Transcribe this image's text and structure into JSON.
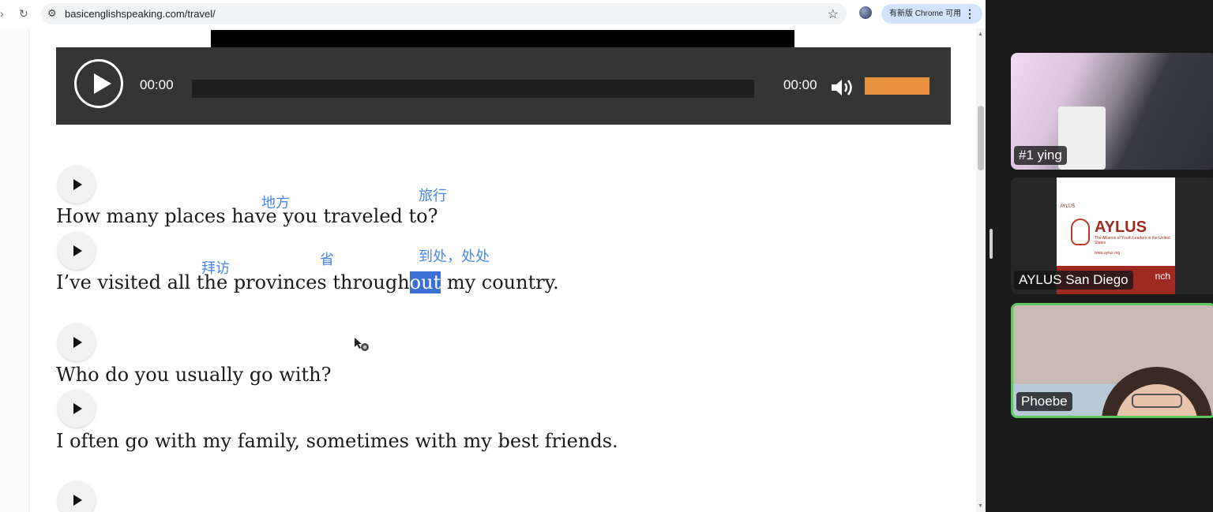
{
  "browser": {
    "url": "basicenglishspeaking.com/travel/",
    "update_chip": "有新版 Chrome 可用"
  },
  "player": {
    "current_time": "00:00",
    "duration": "00:00",
    "volume_level": 1.0,
    "colors": {
      "bar": "#353535",
      "volume": "#e8913f"
    }
  },
  "lines": [
    {
      "text": "How many places have you traveled to?"
    },
    {
      "before": "I’ve visited all the provinces through",
      "selected": "out",
      "after": " my country."
    },
    {
      "text": "Who do you usually go with?"
    },
    {
      "text": "I often go with my family, sometimes with my best friends."
    }
  ],
  "glosses": [
    "地方",
    "旅行",
    "拜访",
    "省",
    "到处，处处"
  ],
  "participants": [
    {
      "name": "#1 ying"
    },
    {
      "name": "AYLUS San Diego"
    },
    {
      "name": "Phoebe",
      "active_speaker": true
    }
  ],
  "slide": {
    "org_small": "AYLUS",
    "brand": "AYLUS",
    "tagline": "The Alliance of Youth Leaders in the United States",
    "site": "www.aylus.org",
    "bar_text": "nch"
  }
}
